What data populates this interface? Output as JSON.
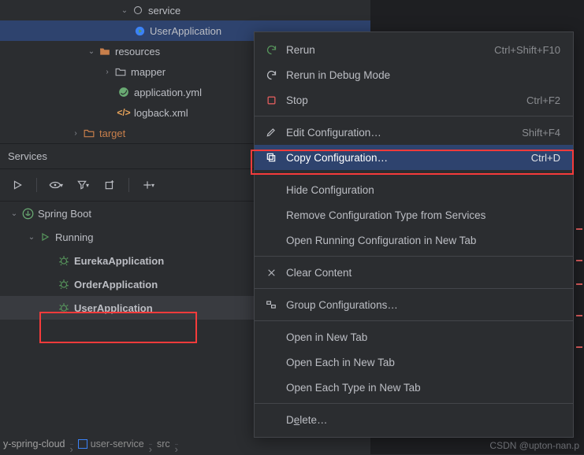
{
  "project_tree": {
    "service_label": "service",
    "user_app": "UserApplication",
    "resources": "resources",
    "mapper": "mapper",
    "app_yml": "application.yml",
    "logback": "logback.xml",
    "target": "target"
  },
  "services": {
    "title": "Services",
    "root": "Spring Boot",
    "running": "Running",
    "apps": {
      "eureka": "EurekaApplication",
      "order": "OrderApplication",
      "user": "UserApplication"
    }
  },
  "menu": {
    "rerun": {
      "label": "Rerun",
      "shortcut": "Ctrl+Shift+F10"
    },
    "rerun_debug": {
      "label": "Rerun in Debug Mode"
    },
    "stop": {
      "label": "Stop",
      "shortcut": "Ctrl+F2"
    },
    "edit_cfg": {
      "label": "Edit Configuration…",
      "shortcut": "Shift+F4"
    },
    "copy_cfg": {
      "label": "Copy Configuration…",
      "shortcut": "Ctrl+D"
    },
    "hide_cfg": {
      "label": "Hide Configuration"
    },
    "remove_type": {
      "label": "Remove Configuration Type from Services"
    },
    "open_running": {
      "label": "Open Running Configuration in New Tab"
    },
    "clear": {
      "label": "Clear Content"
    },
    "group": {
      "label": "Group Configurations…"
    },
    "open_new": {
      "label": "Open in New Tab"
    },
    "open_each": {
      "label": "Open Each in New Tab"
    },
    "open_type": {
      "label": "Open Each Type in New Tab"
    },
    "delete": {
      "label_pre": "D",
      "label_u": "e",
      "label_post": "lete…"
    }
  },
  "breadcrumb": {
    "root": "y-spring-cloud",
    "mod": "user-service",
    "src": "src"
  },
  "watermark": "CSDN @upton-nan.p"
}
